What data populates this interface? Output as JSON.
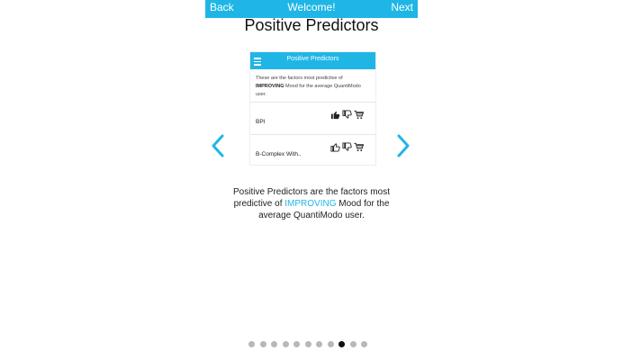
{
  "header": {
    "back_label": "Back",
    "title": "Welcome!",
    "next_label": "Next",
    "color": "#1fb6e6"
  },
  "page_title": "Positive Predictors",
  "preview": {
    "title": "Positive Predictors",
    "desc_intro": "These are the factors most predictive of ",
    "desc_bold": "IMPROVING",
    "desc_outro": " Mood for the average QuantiModo user.",
    "rows": [
      {
        "name": "BPI",
        "thumbs_up": "thumbs-up-filled-icon",
        "thumbs_down": "thumbs-down-icon",
        "cart": "cart-icon"
      },
      {
        "name": "B-Complex With..",
        "thumbs_up": "thumbs-up-icon",
        "thumbs_down": "thumbs-down-icon",
        "cart": "cart-icon"
      }
    ]
  },
  "description": {
    "part1": "Positive Predictors are the factors most predictive of ",
    "highlight": "IMPROVING",
    "part2": " Mood for the average QuantiModo user."
  },
  "nav": {
    "prev_icon": "chevron-left-icon",
    "next_icon": "chevron-right-icon",
    "color": "#1fb6e6"
  },
  "pagination": {
    "total": 11,
    "active_index": 8
  }
}
